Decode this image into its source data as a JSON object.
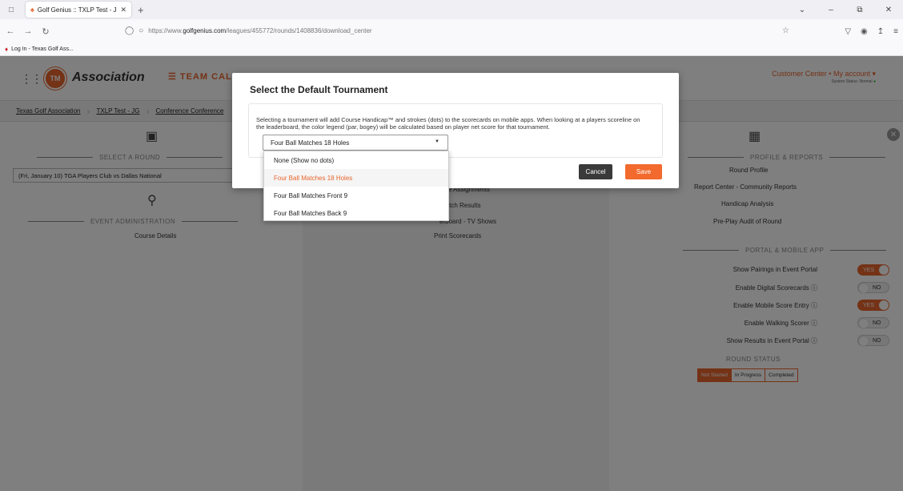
{
  "browser": {
    "tab_title": "Golf Genius :: TXLP Test - JG : Co",
    "url_domain": "golfgenius.com",
    "url_prefix": "https://www.",
    "url_path": "/leagues/455772/rounds/1408836/download_center",
    "bookmark": "Log In - Texas Golf Ass..."
  },
  "header": {
    "logo_initials": "TM",
    "logo_text": "Association",
    "team_calendar": "☰ TEAM CAL",
    "account": "Customer Center • My account ▾",
    "system_status": "System Status: Normal"
  },
  "breadcrumbs": [
    "Texas Golf Association",
    "TXLP Test - JG",
    "Conference Conference"
  ],
  "left_col": {
    "select_round_title": "SELECT A ROUND",
    "round_value": "(Fri, January 10) TGA Players Club vs Dallas National",
    "event_admin_title": "EVENT ADMINISTRATION",
    "course_details": "Course Details"
  },
  "mid_col": {
    "tee_assignments": "& Tee Assignments",
    "match_results": "Match Results",
    "leaderboard_tv": "erboard - TV Shows",
    "print_scorecards": "Print Scorecards"
  },
  "right_col": {
    "profile_title": "PROFILE & REPORTS",
    "round_profile": "Round Profile",
    "report_center": "Report Center - Community Reports",
    "handicap_analysis": "Handicap Analysis",
    "pre_play_audit": "Pre-Play Audit of Round",
    "portal_title": "PORTAL & MOBILE APP",
    "toggles": [
      {
        "label": "Show Pairings in Event Portal",
        "value": "YES"
      },
      {
        "label": "Enable Digital Scorecards ⓘ",
        "value": "NO"
      },
      {
        "label": "Enable Mobile Score Entry ⓘ",
        "value": "YES"
      },
      {
        "label": "Enable Walking Scorer ⓘ",
        "value": "NO"
      },
      {
        "label": "Show Results in Event Portal ⓘ",
        "value": "NO"
      }
    ],
    "round_status_title": "ROUND STATUS",
    "status_options": [
      "Not Started",
      "In Progress",
      "Completed"
    ]
  },
  "modal": {
    "title": "Select the Default Tournament",
    "description": "Selecting a tournament will add Course Handicap™ and strokes (dots) to the scorecards on mobile apps. When looking at a players scoreline on the leaderboard, the color legend (par, bogey) will be calculated based on player net score for that tournament.",
    "selected": "Four Ball Matches 18 Holes",
    "options": [
      "None (Show no dots)",
      "Four Ball Matches 18 Holes",
      "Four Ball Matches Front 9",
      "Four Ball Matches Back 9"
    ],
    "cancel_label": "Cancel",
    "save_label": "Save"
  }
}
